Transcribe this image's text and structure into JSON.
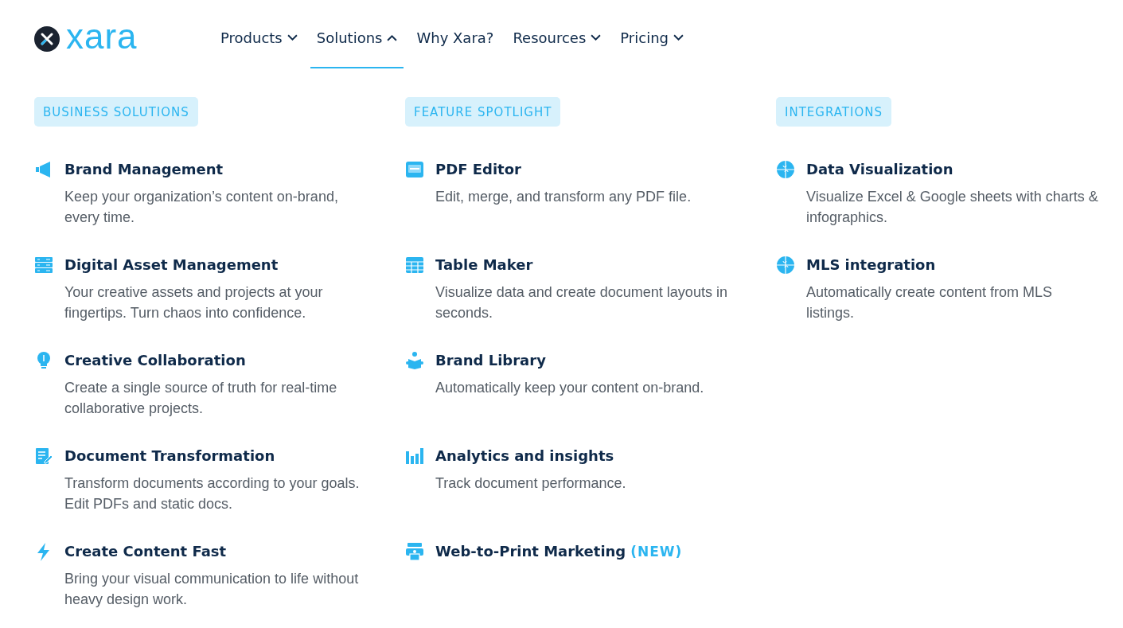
{
  "logo": {
    "text": "xara"
  },
  "nav": [
    {
      "label": "Products",
      "selected": false,
      "menu": true
    },
    {
      "label": "Solutions",
      "selected": true,
      "menu": true
    },
    {
      "label": "Why Xara?",
      "selected": false,
      "menu": false
    },
    {
      "label": "Resources",
      "selected": false,
      "menu": true
    },
    {
      "label": "Pricing",
      "selected": false,
      "menu": true
    }
  ],
  "columns": [
    {
      "heading": "BUSINESS SOLUTIONS",
      "items": [
        {
          "kind": "megaphone",
          "title": "Brand Management",
          "description": "Keep your organization’s content on-brand, every time."
        },
        {
          "kind": "server",
          "title": "Digital Asset Management",
          "description": "Your creative assets and projects at your fingertips. Turn chaos into confidence."
        },
        {
          "kind": "bulb",
          "title": "Creative Collaboration",
          "description": "Create a single source of truth for real-time collaborative projects."
        },
        {
          "kind": "document",
          "title": "Document Transformation",
          "description": "Transform documents according to your goals. Edit PDFs and static docs."
        },
        {
          "kind": "bolt",
          "title": "Create Content Fast",
          "description": "Bring your visual communication to life without heavy design work."
        }
      ]
    },
    {
      "heading": "FEATURE SPOTLIGHT",
      "items": [
        {
          "kind": "pdf",
          "title": "PDF Editor",
          "description": "Edit, merge, and transform any PDF file."
        },
        {
          "kind": "table",
          "title": "Table Maker",
          "description": "Visualize data and create document layouts in seconds."
        },
        {
          "kind": "reader",
          "title": "Brand Library",
          "description": "Automatically keep your content on-brand."
        },
        {
          "kind": "chart",
          "title": "Analytics and insights",
          "description": "Track document performance."
        },
        {
          "kind": "printer",
          "title": "Web-to-Print Marketing",
          "badge": "(NEW)"
        }
      ]
    },
    {
      "heading": "INTEGRATIONS",
      "items": [
        {
          "kind": "puzzle",
          "title": "Data Visualization",
          "description": "Visualize Excel & Google sheets with charts & infographics."
        },
        {
          "kind": "puzzle",
          "title": "MLS integration",
          "description": "Automatically create content from MLS listings."
        }
      ]
    }
  ]
}
